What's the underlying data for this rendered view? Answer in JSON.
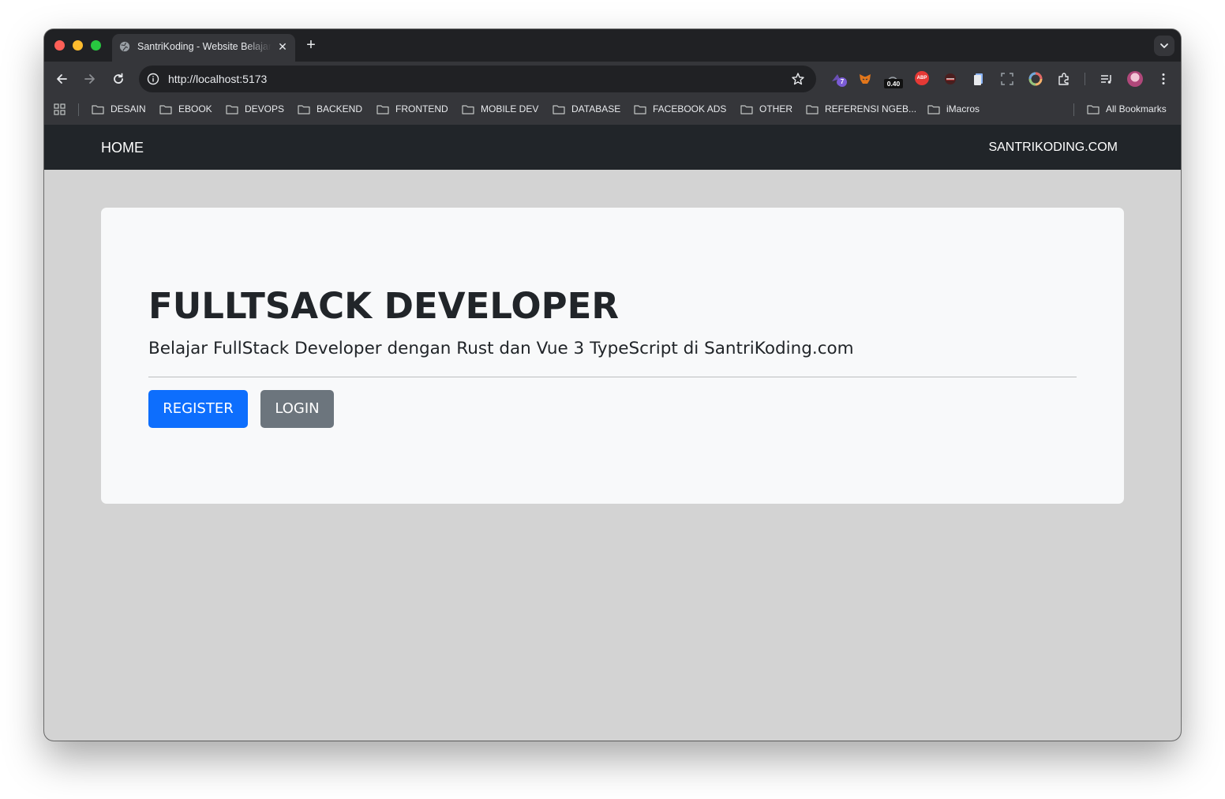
{
  "browser": {
    "tab": {
      "title": "SantriKoding - Website Belajar Coding",
      "close_glyph": "✕"
    },
    "new_tab_glyph": "+",
    "address": "http://localhost:5173",
    "extension_badge_count": "7",
    "extension_meter": "0.40",
    "extension_abp": "ABP",
    "bookmarks": [
      {
        "label": "DESAIN"
      },
      {
        "label": "EBOOK"
      },
      {
        "label": "DEVOPS"
      },
      {
        "label": "BACKEND"
      },
      {
        "label": "FRONTEND"
      },
      {
        "label": "MOBILE DEV"
      },
      {
        "label": "DATABASE"
      },
      {
        "label": "FACEBOOK ADS"
      },
      {
        "label": "OTHER"
      },
      {
        "label": "REFERENSI NGEB..."
      },
      {
        "label": "iMacros"
      }
    ],
    "all_bookmarks": "All Bookmarks"
  },
  "page": {
    "nav": {
      "home": "HOME",
      "brand": "SANTRIKODING.COM"
    },
    "hero": {
      "title": "FULLTSACK DEVELOPER",
      "lead": "Belajar FullStack Developer dengan Rust dan Vue 3 TypeScript di SantriKoding.com",
      "register": "REGISTER",
      "login": "LOGIN"
    },
    "colors": {
      "navbar": "#212529",
      "page_bg": "#d3d3d3",
      "card_bg": "#f8f9fa",
      "primary": "#0d6efd",
      "secondary": "#6c757d"
    }
  }
}
